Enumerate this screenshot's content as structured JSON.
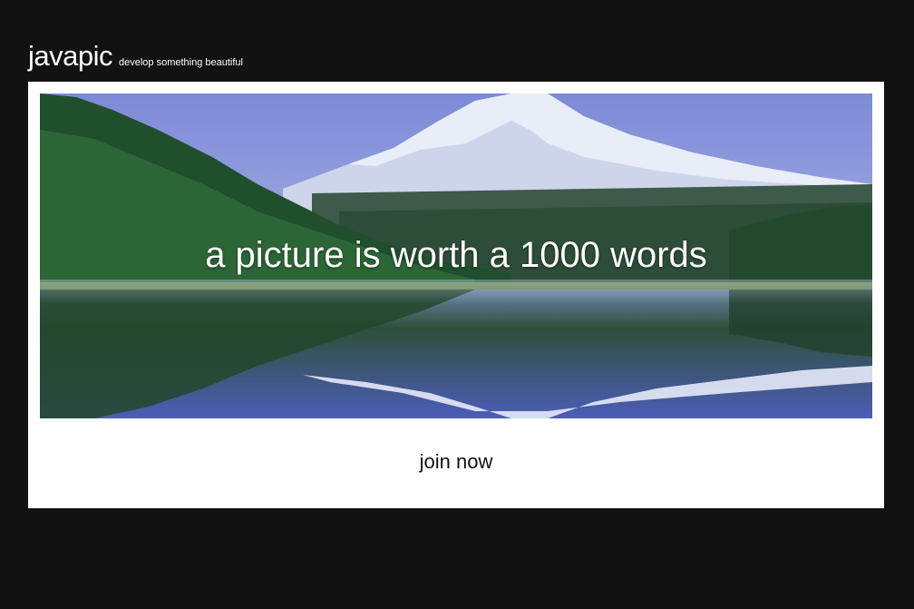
{
  "header": {
    "brand": "javapic",
    "tagline": "develop something beautiful"
  },
  "hero": {
    "caption": "a picture is worth a 1000 words",
    "image_subject": "mountain-lake-landscape"
  },
  "cta": {
    "label": "join now"
  },
  "colors": {
    "page_background": "#121212",
    "card_background": "#ffffff",
    "sky": "#8a95d8",
    "forest": "#2f5a2f",
    "snow": "#f2f4fb"
  }
}
